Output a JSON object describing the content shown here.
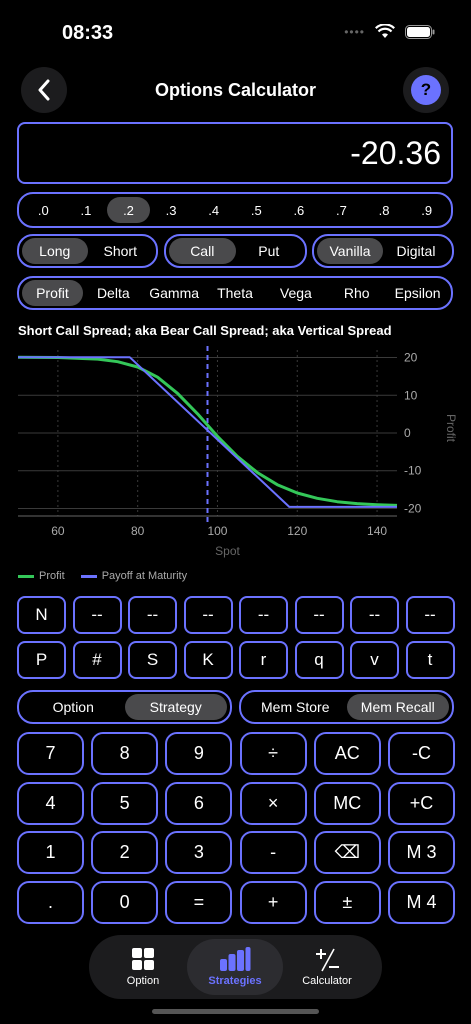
{
  "status": {
    "time": "08:33"
  },
  "header": {
    "title": "Options Calculator",
    "help_label": "?"
  },
  "display": {
    "value": "-20.36"
  },
  "decimals": {
    "items": [
      ".0",
      ".1",
      ".2",
      ".3",
      ".4",
      ".5",
      ".6",
      ".7",
      ".8",
      ".9"
    ],
    "selected": ".2"
  },
  "position": {
    "items": [
      "Long",
      "Short"
    ],
    "selected": "Long"
  },
  "option_type": {
    "items": [
      "Call",
      "Put"
    ],
    "selected": "Call"
  },
  "style": {
    "items": [
      "Vanilla",
      "Digital"
    ],
    "selected": "Vanilla"
  },
  "metric_tabs": {
    "items": [
      "Profit",
      "Delta",
      "Gamma",
      "Theta",
      "Vega",
      "Rho",
      "Epsilon"
    ],
    "selected": "Profit"
  },
  "chart_data": {
    "type": "line",
    "title": "Short Call Spread; aka Bear Call Spread; aka Vertical Spread",
    "xlabel": "Spot",
    "ylabel": "Profit",
    "xlim": [
      50,
      145
    ],
    "ylim": [
      -22,
      22
    ],
    "x_ticks": [
      60,
      80,
      100,
      120,
      140
    ],
    "y_ticks": [
      20,
      10,
      0,
      -10,
      -20
    ],
    "vertical_marker_x": 97.5,
    "grid": true,
    "legend_position": "bottom-left",
    "series": [
      {
        "name": "Profit",
        "color": "#34c759",
        "x": [
          50,
          60,
          70,
          75,
          80,
          85,
          90,
          95,
          100,
          105,
          110,
          115,
          120,
          125,
          130,
          135,
          140,
          145
        ],
        "y": [
          20.1,
          20.0,
          19.6,
          18.9,
          17.5,
          14.8,
          10.5,
          5.1,
          -0.9,
          -6.2,
          -10.5,
          -13.7,
          -15.9,
          -17.3,
          -18.2,
          -18.7,
          -19.0,
          -19.2
        ]
      },
      {
        "name": "Payoff at Maturity",
        "color": "#6b72ff",
        "x": [
          50,
          78,
          118,
          145
        ],
        "y": [
          20.1,
          20.1,
          -19.6,
          -19.6
        ]
      }
    ]
  },
  "variables": {
    "row1": [
      "N",
      "--",
      "--",
      "--",
      "--",
      "--",
      "--",
      "--"
    ],
    "row2": [
      "P",
      "#",
      "S",
      "K",
      "r",
      "q",
      "v",
      "t"
    ]
  },
  "mode_toggle": {
    "items": [
      "Option",
      "Strategy"
    ],
    "selected": "Strategy"
  },
  "mem_toggle": {
    "items": [
      "Mem Store",
      "Mem Recall"
    ],
    "selected": "Mem Recall"
  },
  "keypad": [
    [
      "7",
      "8",
      "9",
      "÷",
      "AC",
      "-C"
    ],
    [
      "4",
      "5",
      "6",
      "×",
      "MC",
      "+C"
    ],
    [
      "1",
      "2",
      "3",
      "-",
      "⌫",
      "M 3"
    ],
    [
      ".",
      "0",
      "=",
      "+",
      "±",
      "M 4"
    ]
  ],
  "tabbar": {
    "items": [
      {
        "label": "Option",
        "icon": "grid-icon"
      },
      {
        "label": "Strategies",
        "icon": "bar-chart-icon"
      },
      {
        "label": "Calculator",
        "icon": "plus-minus-icon"
      }
    ],
    "selected": "Strategies"
  },
  "colors": {
    "accent": "#6b72ff",
    "profit": "#34c759",
    "selected_segment": "#4a4a4c"
  }
}
